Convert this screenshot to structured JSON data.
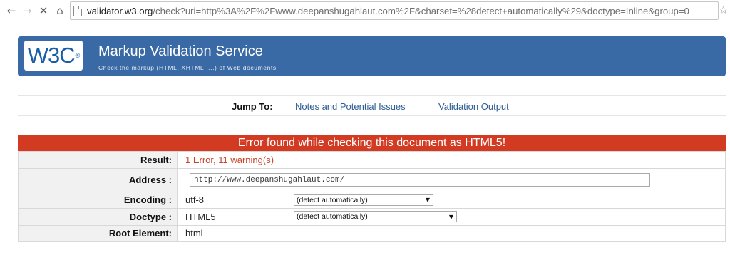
{
  "browser": {
    "url_domain": "validator.w3.org",
    "url_path": "/check?uri=http%3A%2F%2Fwww.deepanshugahlaut.com%2F&charset=%28detect+automatically%29&doctype=Inline&group=0"
  },
  "banner": {
    "logo_text": "W3C",
    "logo_mark": "®",
    "title": "Markup Validation Service",
    "subtitle": "Check the markup (HTML, XHTML, ...) of Web documents"
  },
  "jump": {
    "label": "Jump To:",
    "links": [
      "Notes and Potential Issues",
      "Validation Output"
    ]
  },
  "error_header": "Error found while checking this document as HTML5!",
  "results": {
    "result_label": "Result:",
    "result_value": "1 Error, 11 warning(s)",
    "address_label": "Address :",
    "address_value": "http://www.deepanshugahlaut.com/",
    "encoding_label": "Encoding :",
    "encoding_value": "utf-8",
    "encoding_select": "(detect automatically)",
    "doctype_label": "Doctype :",
    "doctype_value": "HTML5",
    "doctype_select": "(detect automatically)",
    "root_label": "Root Element:",
    "root_value": "html"
  },
  "colors": {
    "banner": "#3a6aa6",
    "error": "#d33a22",
    "link": "#2e5d93"
  }
}
